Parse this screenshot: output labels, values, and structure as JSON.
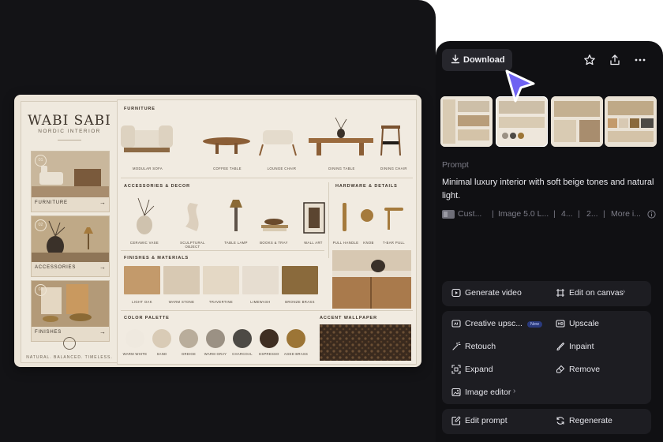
{
  "board": {
    "title": "WABI SABI",
    "subtitle": "NORDIC INTERIOR",
    "cards": [
      {
        "num": "01",
        "label": "FURNITURE"
      },
      {
        "num": "02",
        "label": "ACCESSORIES"
      },
      {
        "num": "03",
        "label": "FINISHES"
      }
    ],
    "tagline": "NATURAL. BALANCED. TIMELESS.",
    "sections": {
      "furniture": "FURNITURE",
      "accessories": "ACCESSORIES & DECOR",
      "hardware": "HARDWARE & DETAILS",
      "finishes": "FINISHES & MATERIALS",
      "palette": "COLOR PALETTE",
      "wallpaper": "ACCENT WALLPAPER"
    },
    "furniture_items": [
      "MODULAR SOFA",
      "COFFEE TABLE",
      "LOUNGE CHAIR",
      "DINING TABLE",
      "DINING CHAIR"
    ],
    "accessory_items": [
      "CERAMIC VASE",
      "SCULPTURAL OBJECT",
      "TABLE LAMP",
      "BOOKS & TRAY",
      "WALL ART"
    ],
    "hardware_items": [
      "PULL HANDLE",
      "KNOB",
      "T-BAR PULL"
    ],
    "finishes": [
      {
        "label": "LIGHT OAK",
        "color": "#c39a6b"
      },
      {
        "label": "WARM STONE",
        "color": "#d8c9b3"
      },
      {
        "label": "TRAVERTINE",
        "color": "#e4d8c5"
      },
      {
        "label": "LIMEWASH",
        "color": "#e6ddd0"
      },
      {
        "label": "BRONZE BRASS",
        "color": "#8a6a3c"
      }
    ],
    "palette": [
      {
        "label": "WARM WHITE",
        "color": "#efe9df"
      },
      {
        "label": "SAND",
        "color": "#d9cbb6"
      },
      {
        "label": "GREIGE",
        "color": "#b9ad9b"
      },
      {
        "label": "WARM GRAY",
        "color": "#9b9184"
      },
      {
        "label": "CHARCOAL",
        "color": "#4d4a45"
      },
      {
        "label": "ESPRESSO",
        "color": "#3f2e22"
      },
      {
        "label": "AGED BRASS",
        "color": "#9c7536"
      }
    ]
  },
  "panel": {
    "download_label": "Download",
    "prompt_label": "Prompt",
    "prompt_text": "Minimal luxury interior with soft beige tones and natural light.",
    "meta": [
      "Cust...",
      "Image 5.0 L...",
      "4...",
      "2...",
      "More i..."
    ],
    "group1": {
      "generate_video": "Generate video",
      "edit_on_canvas": "Edit on canvas"
    },
    "group2": {
      "creative_upscale": "Creative upsc...",
      "new_badge": "New",
      "upscale": "Upscale",
      "retouch": "Retouch",
      "inpaint": "Inpaint",
      "expand": "Expand",
      "remove": "Remove",
      "image_editor": "Image editor"
    },
    "group3": {
      "edit_prompt": "Edit prompt",
      "regenerate": "Regenerate"
    }
  }
}
